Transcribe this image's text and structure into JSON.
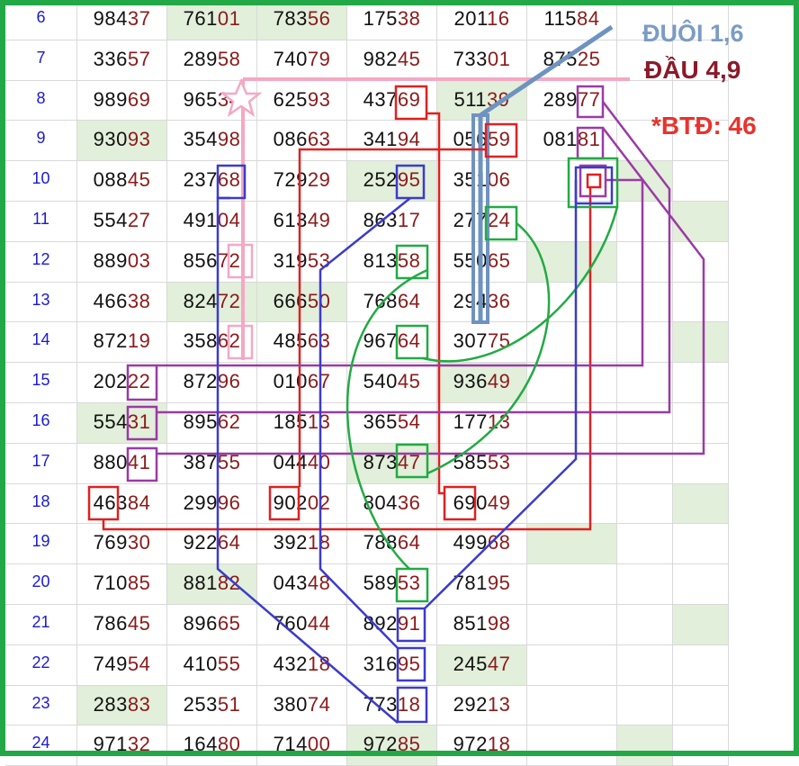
{
  "labels": {
    "duoi": "ĐUÔI 1,6",
    "dau": "ĐẦU 4,9",
    "btd": "*BTĐ: 46"
  },
  "colors": {
    "index": "#1a1ad6",
    "head_digits": "#111111",
    "tail_digits": "#8b1a1a",
    "cell_highlight": "#e2efda",
    "frame": "#22a846",
    "blue_box": "#3b3bcc",
    "red_box": "#e02020",
    "green_box": "#22aa44",
    "purple_box": "#9a3aa6",
    "pink_line": "#f4a8c4",
    "steel_line": "#6f93c0"
  },
  "rows": [
    {
      "index": "6",
      "values": [
        "98437",
        "76101",
        "78356",
        "17538",
        "20116",
        "11584"
      ],
      "highlight": [
        false,
        true,
        true,
        false,
        false,
        false,
        false,
        false
      ]
    },
    {
      "index": "7",
      "values": [
        "33657",
        "28958",
        "74079",
        "98245",
        "73301",
        "87525"
      ],
      "highlight": [
        false,
        false,
        false,
        false,
        false,
        false,
        false,
        false
      ]
    },
    {
      "index": "8",
      "values": [
        "98969",
        "96534",
        "62593",
        "43769",
        "51139",
        "28977"
      ],
      "highlight": [
        false,
        false,
        false,
        false,
        true,
        false,
        false,
        false
      ]
    },
    {
      "index": "9",
      "values": [
        "93093",
        "35498",
        "08663",
        "34194",
        "05659",
        "08181"
      ],
      "highlight": [
        true,
        false,
        false,
        false,
        false,
        false,
        false,
        false
      ]
    },
    {
      "index": "10",
      "values": [
        "08845",
        "23768",
        "72929",
        "25295",
        "35106",
        ""
      ],
      "highlight": [
        false,
        false,
        false,
        true,
        false,
        false,
        true,
        false
      ]
    },
    {
      "index": "11",
      "values": [
        "55427",
        "49104",
        "61349",
        "86317",
        "27724",
        ""
      ],
      "highlight": [
        false,
        false,
        false,
        false,
        false,
        false,
        false,
        true
      ]
    },
    {
      "index": "12",
      "values": [
        "88903",
        "85672",
        "31953",
        "81358",
        "55065",
        ""
      ],
      "highlight": [
        false,
        false,
        false,
        false,
        false,
        true,
        false,
        false
      ]
    },
    {
      "index": "13",
      "values": [
        "46638",
        "82472",
        "66650",
        "76864",
        "29436",
        ""
      ],
      "highlight": [
        false,
        true,
        true,
        false,
        false,
        false,
        false,
        false
      ]
    },
    {
      "index": "14",
      "values": [
        "87219",
        "35862",
        "48563",
        "96764",
        "30775",
        ""
      ],
      "highlight": [
        false,
        false,
        false,
        false,
        false,
        false,
        false,
        true
      ]
    },
    {
      "index": "15",
      "values": [
        "20222",
        "87296",
        "01067",
        "54045",
        "93649",
        ""
      ],
      "highlight": [
        false,
        false,
        false,
        false,
        true,
        false,
        false,
        false
      ]
    },
    {
      "index": "16",
      "values": [
        "55431",
        "89562",
        "18513",
        "36554",
        "17713",
        ""
      ],
      "highlight": [
        true,
        false,
        false,
        false,
        false,
        false,
        false,
        false
      ]
    },
    {
      "index": "17",
      "values": [
        "88041",
        "38755",
        "04440",
        "87347",
        "58553",
        ""
      ],
      "highlight": [
        false,
        false,
        false,
        true,
        false,
        false,
        false,
        false
      ]
    },
    {
      "index": "18",
      "values": [
        "46384",
        "29996",
        "90202",
        "80436",
        "69049",
        ""
      ],
      "highlight": [
        false,
        false,
        false,
        false,
        false,
        false,
        false,
        true
      ]
    },
    {
      "index": "19",
      "values": [
        "76930",
        "92264",
        "39218",
        "78864",
        "49968",
        ""
      ],
      "highlight": [
        false,
        false,
        false,
        false,
        false,
        true,
        false,
        false
      ]
    },
    {
      "index": "20",
      "values": [
        "71085",
        "88182",
        "04348",
        "58953",
        "78195",
        ""
      ],
      "highlight": [
        false,
        true,
        false,
        false,
        false,
        false,
        false,
        false
      ]
    },
    {
      "index": "21",
      "values": [
        "78645",
        "89665",
        "76044",
        "89291",
        "85198",
        ""
      ],
      "highlight": [
        false,
        false,
        false,
        false,
        false,
        false,
        false,
        true
      ]
    },
    {
      "index": "22",
      "values": [
        "74954",
        "41055",
        "43218",
        "31695",
        "24547",
        ""
      ],
      "highlight": [
        false,
        false,
        false,
        false,
        true,
        false,
        false,
        false
      ]
    },
    {
      "index": "23",
      "values": [
        "28383",
        "25351",
        "38074",
        "77318",
        "29213",
        ""
      ],
      "highlight": [
        true,
        false,
        false,
        false,
        false,
        false,
        false,
        false
      ]
    },
    {
      "index": "24",
      "values": [
        "97132",
        "16480",
        "71400",
        "97285",
        "97218",
        ""
      ],
      "highlight": [
        false,
        false,
        false,
        true,
        false,
        false,
        true,
        false
      ]
    }
  ]
}
